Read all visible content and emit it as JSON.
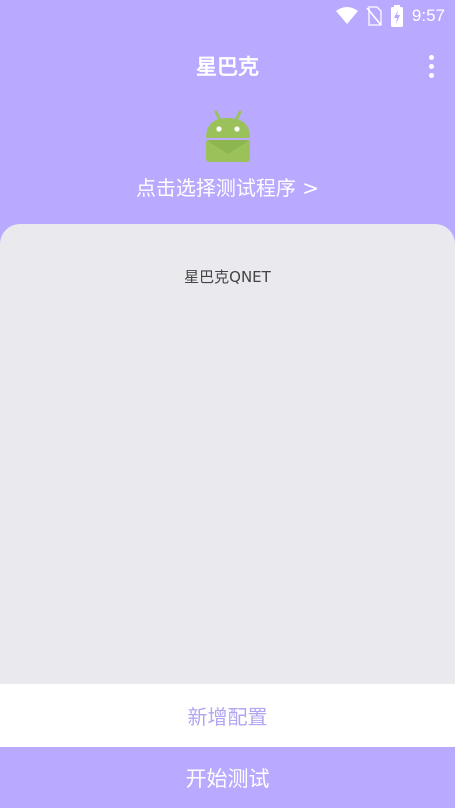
{
  "status_bar": {
    "time": "9:57",
    "icons": [
      "wifi-icon",
      "no-sim-icon",
      "battery-charging-icon"
    ]
  },
  "header": {
    "title": "星巴克",
    "menu_icon": "more-vertical-icon"
  },
  "app_selector": {
    "icon": "android-icon",
    "label": "点击选择测试程序 >"
  },
  "config_list": {
    "items": [
      "星巴克QNET"
    ]
  },
  "actions": {
    "add_config": "新增配置",
    "start_test": "开始测试"
  },
  "colors": {
    "primary": "#b9aaff",
    "panel_bg": "#e9e9ee",
    "add_text": "#b3a5f2",
    "android_green": "#9bc25a"
  }
}
